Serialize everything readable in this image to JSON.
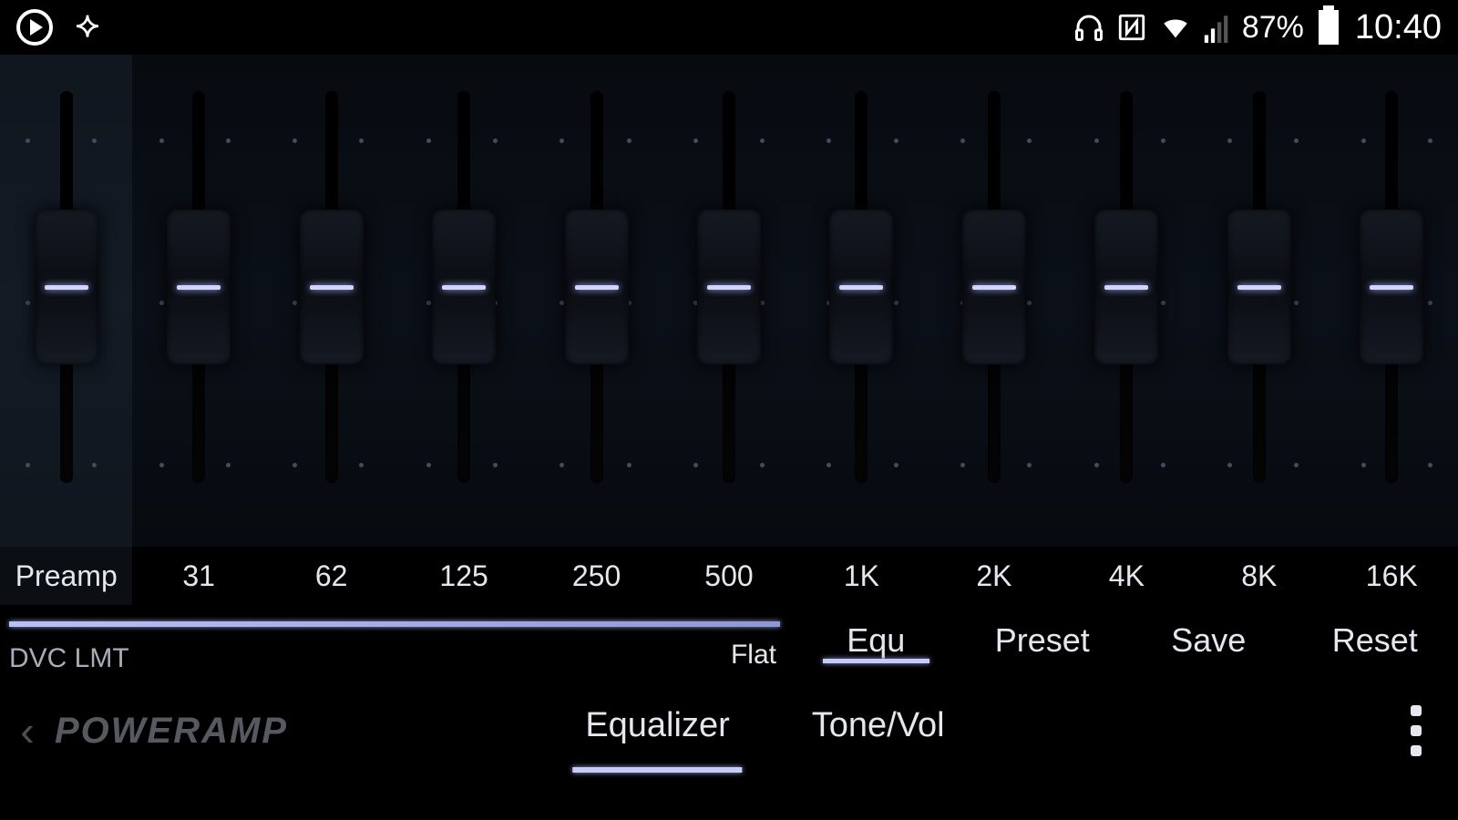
{
  "statusbar": {
    "battery_pct": "87%",
    "clock": "10:40"
  },
  "eq": {
    "preamp_label": "Preamp",
    "bands": [
      "31",
      "62",
      "125",
      "250",
      "500",
      "1K",
      "2K",
      "4K",
      "8K",
      "16K"
    ],
    "preamp_value": 0,
    "band_values": [
      0,
      0,
      0,
      0,
      0,
      0,
      0,
      0,
      0,
      0
    ]
  },
  "meter": {
    "dvc_lmt": "DVC LMT",
    "preset_name": "Flat"
  },
  "buttons": {
    "equ": "Equ",
    "preset": "Preset",
    "save": "Save",
    "reset": "Reset"
  },
  "nav": {
    "brand": "Poweramp",
    "equalizer": "Equalizer",
    "tonevol": "Tone/Vol"
  }
}
